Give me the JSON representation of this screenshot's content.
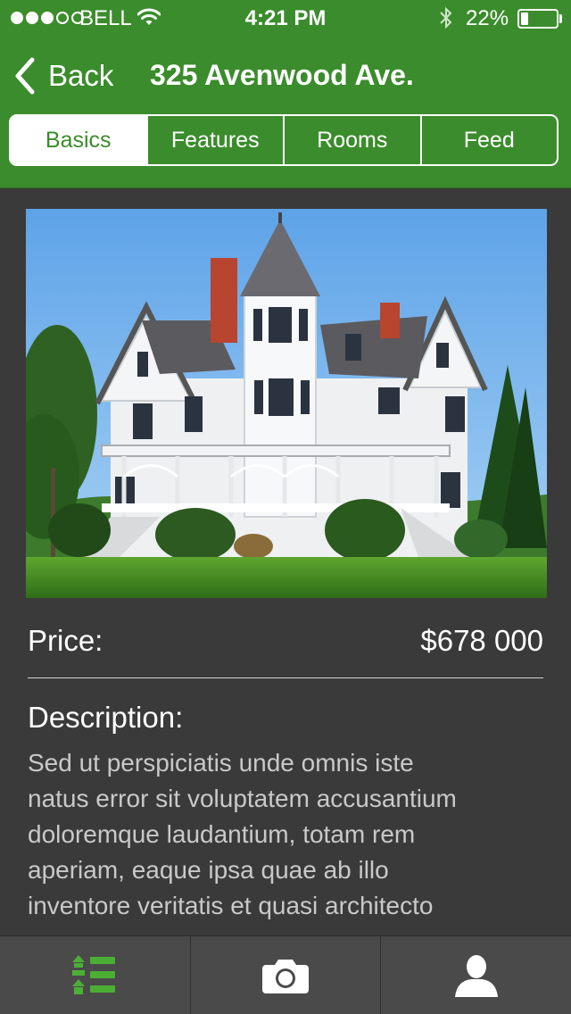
{
  "status_bar": {
    "carrier": "BELL",
    "time": "4:21 PM",
    "battery_percent_label": "22%",
    "battery_level": 0.22,
    "signal_bars_filled": 3,
    "signal_bars_total": 5
  },
  "nav": {
    "back_label": "Back",
    "title": "325 Avenwood Ave."
  },
  "segments": [
    {
      "label": "Basics",
      "active": true
    },
    {
      "label": "Features",
      "active": false
    },
    {
      "label": "Rooms",
      "active": false
    },
    {
      "label": "Feed",
      "active": false
    }
  ],
  "listing": {
    "price_label": "Price:",
    "price_value": "$678 000",
    "description_heading": "Description:",
    "description_lines": [
      "Sed ut perspiciatis unde omnis iste",
      "natus error sit voluptatem accusantium",
      "doloremque laudantium, totam rem",
      "aperiam, eaque ipsa quae ab illo",
      "inventore veritatis et quasi architecto"
    ]
  },
  "tabbar": {
    "items": [
      {
        "icon": "list-icon",
        "active": true
      },
      {
        "icon": "camera-icon",
        "active": false
      },
      {
        "icon": "user-icon",
        "active": false
      }
    ]
  },
  "colors": {
    "brand_green": "#3b8c2c",
    "background": "#3a3a3a",
    "tabbar": "#4a4a4a",
    "active_icon": "#4caf35"
  },
  "icons": {
    "wifi": "wifi-icon",
    "bluetooth": "bluetooth-icon",
    "back": "chevron-left-icon"
  }
}
